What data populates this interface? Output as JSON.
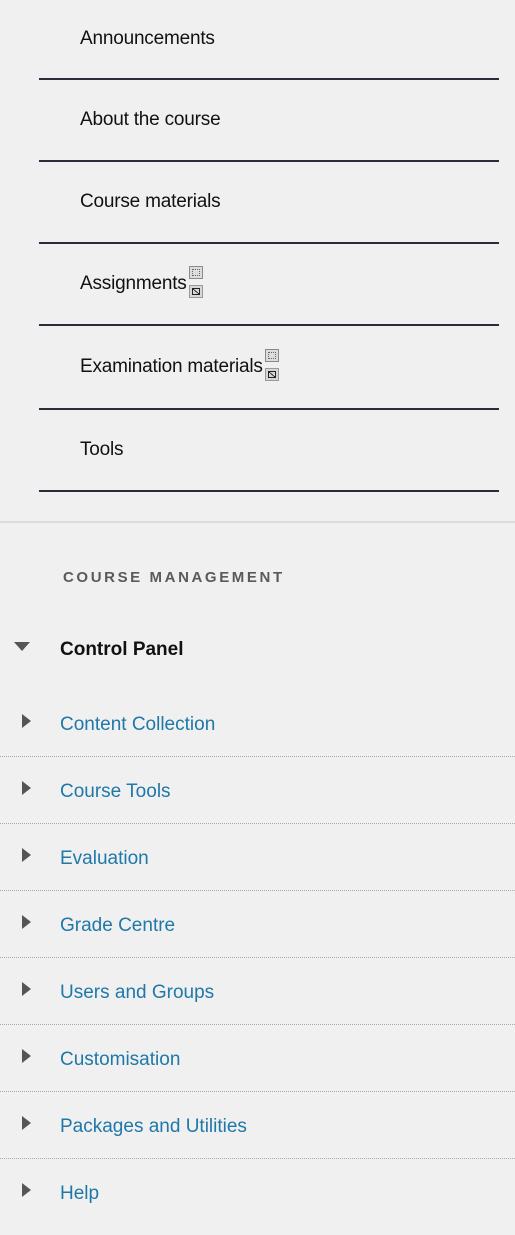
{
  "course_menu": {
    "items": [
      {
        "label": "Announcements"
      },
      {
        "label": "About the course"
      },
      {
        "label": "Course materials"
      },
      {
        "label": "Assignments"
      },
      {
        "label": "Examination materials"
      },
      {
        "label": "Tools"
      }
    ]
  },
  "course_management": {
    "title": "COURSE MANAGEMENT",
    "control_panel": {
      "label": "Control Panel",
      "items": [
        {
          "label": "Content Collection"
        },
        {
          "label": "Course Tools"
        },
        {
          "label": "Evaluation"
        },
        {
          "label": "Grade Centre"
        },
        {
          "label": "Users and Groups"
        },
        {
          "label": "Customisation"
        },
        {
          "label": "Packages and Utilities"
        },
        {
          "label": "Help"
        }
      ]
    }
  },
  "colors": {
    "background": "#f0f0f0",
    "link": "#1f78a8",
    "text": "#111111",
    "rule": "#2b2b3a"
  },
  "icons": {
    "visibility_hidden": "dotted-square-icon",
    "visibility_blocked": "slashed-square-icon",
    "expanded": "caret-down-icon",
    "collapsed": "caret-right-icon"
  }
}
